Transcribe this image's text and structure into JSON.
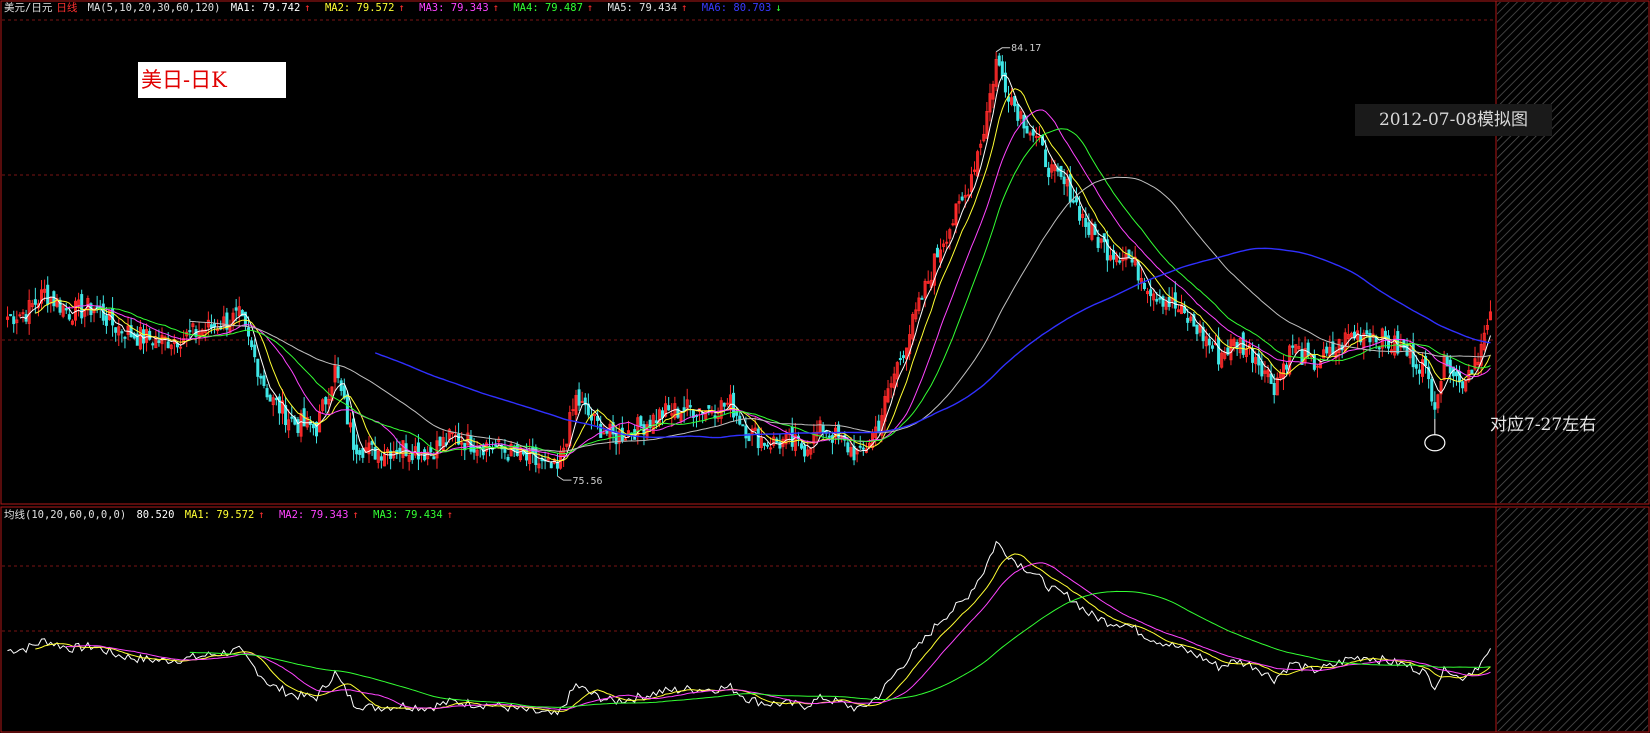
{
  "header": {
    "symbol": "美元/日元",
    "period": "日线",
    "ma_params": "MA(5,10,20,30,60,120)",
    "ma1": "MA1: 79.742",
    "ma2": "MA2: 79.572",
    "ma3": "MA3: 79.343",
    "ma4": "MA4: 79.487",
    "ma5": "MA5: 79.434",
    "ma6": "MA6: 80.703"
  },
  "indicator_header": {
    "name": "均线(10,20,60,0,0,0)",
    "value": "80.520",
    "ma1": "MA1: 79.572",
    "ma2": "MA2: 79.343",
    "ma3": "MA3: 79.434"
  },
  "title_box": "美日-日K",
  "date_box": "2012-07-08模拟图",
  "annotation": "对应7-27左右",
  "high_label": "84.17",
  "low_label": "75.56",
  "colors": {
    "up": "#ff2a2a",
    "down": "#3fe6e6",
    "ma5": "#ffffff",
    "ma10": "#ffff33",
    "ma20": "#ff44ff",
    "ma30": "#33ff33",
    "ma60": "#c0c0c0",
    "ma120": "#3030ff",
    "grid": "#7a1414",
    "frame": "#b01818"
  },
  "chart_data": {
    "type": "candlestick",
    "title": "",
    "main_ylim": [
      75.0,
      85.0
    ],
    "ind_ylim": [
      75.0,
      85.0
    ],
    "anchors": [
      [
        0,
        78.8
      ],
      [
        6,
        78.9
      ],
      [
        12,
        79.3
      ],
      [
        20,
        78.9
      ],
      [
        28,
        79.0
      ],
      [
        35,
        78.6
      ],
      [
        42,
        78.4
      ],
      [
        50,
        78.3
      ],
      [
        58,
        78.4
      ],
      [
        66,
        78.6
      ],
      [
        75,
        78.8
      ],
      [
        85,
        77.1
      ],
      [
        93,
        76.6
      ],
      [
        100,
        76.5
      ],
      [
        106,
        77.7
      ],
      [
        112,
        76.2
      ],
      [
        118,
        76.0
      ],
      [
        128,
        76.1
      ],
      [
        136,
        76.0
      ],
      [
        144,
        76.3
      ],
      [
        150,
        76.2
      ],
      [
        158,
        76.1
      ],
      [
        166,
        75.9
      ],
      [
        174,
        75.7
      ],
      [
        178,
        75.6
      ],
      [
        184,
        77.1
      ],
      [
        190,
        76.6
      ],
      [
        196,
        76.3
      ],
      [
        204,
        76.5
      ],
      [
        212,
        76.8
      ],
      [
        220,
        76.9
      ],
      [
        228,
        76.9
      ],
      [
        234,
        77.0
      ],
      [
        240,
        76.4
      ],
      [
        246,
        76.2
      ],
      [
        252,
        76.2
      ],
      [
        258,
        76.1
      ],
      [
        264,
        76.5
      ],
      [
        270,
        76.2
      ],
      [
        276,
        75.9
      ],
      [
        282,
        76.6
      ],
      [
        288,
        77.8
      ],
      [
        295,
        79.0
      ],
      [
        302,
        80.3
      ],
      [
        310,
        81.3
      ],
      [
        316,
        82.7
      ],
      [
        320,
        84.1
      ],
      [
        326,
        83.2
      ],
      [
        332,
        82.6
      ],
      [
        338,
        81.8
      ],
      [
        344,
        81.4
      ],
      [
        350,
        80.6
      ],
      [
        356,
        80.2
      ],
      [
        362,
        80.1
      ],
      [
        370,
        79.4
      ],
      [
        378,
        79.0
      ],
      [
        386,
        78.5
      ],
      [
        392,
        78.0
      ],
      [
        398,
        78.3
      ],
      [
        404,
        78.0
      ],
      [
        410,
        77.4
      ],
      [
        416,
        78.2
      ],
      [
        422,
        77.8
      ],
      [
        428,
        78.0
      ],
      [
        434,
        78.4
      ],
      [
        440,
        78.5
      ],
      [
        446,
        78.3
      ],
      [
        452,
        78.1
      ],
      [
        458,
        77.8
      ],
      [
        462,
        77.1
      ],
      [
        466,
        78.0
      ],
      [
        470,
        77.4
      ],
      [
        474,
        77.8
      ],
      [
        477,
        78.2
      ],
      [
        480,
        78.7
      ]
    ],
    "series": [
      {
        "name": "MA1",
        "period": 5
      },
      {
        "name": "MA2",
        "period": 10
      },
      {
        "name": "MA3",
        "period": 20
      },
      {
        "name": "MA4",
        "period": 30
      },
      {
        "name": "MA5",
        "period": 60
      },
      {
        "name": "MA6",
        "period": 120
      }
    ],
    "indicator_series": [
      {
        "name": "MA1",
        "period": 10
      },
      {
        "name": "MA2",
        "period": 20
      },
      {
        "name": "MA3",
        "period": 60
      }
    ]
  }
}
